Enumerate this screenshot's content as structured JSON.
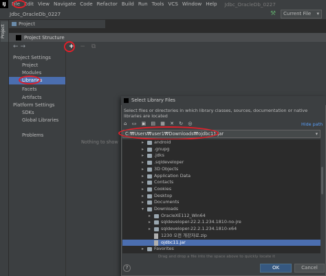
{
  "menubar": {
    "logo": "IJ",
    "items": [
      "File",
      "Edit",
      "View",
      "Navigate",
      "Code",
      "Refactor",
      "Build",
      "Run",
      "Tools",
      "VCS",
      "Window",
      "Help"
    ],
    "window_title": "Jdbc_OracleDb_0227"
  },
  "toolbar": {
    "breadcrumb": "Jdbc_OracleDb_0227",
    "run_config": "Current File"
  },
  "left_strip": {
    "project_tab": "Project"
  },
  "project_panel": {
    "header": "Project"
  },
  "project_structure": {
    "title": "Project Structure",
    "nav": {
      "section_project_settings": "Project Settings",
      "project": "Project",
      "modules": "Modules",
      "libraries": "Libraries",
      "facets": "Facets",
      "artifacts": "Artifacts",
      "section_platform_settings": "Platform Settings",
      "sdks": "SDKs",
      "global_libraries": "Global Libraries",
      "problems": "Problems"
    },
    "middle": {
      "add": "+",
      "remove": "−",
      "copy": "⧉",
      "empty_text": "Nothing to show"
    }
  },
  "select_library_files": {
    "title": "Select Library Files",
    "description": "Select files or directories in which library classes, sources, documentation or native libraries are located",
    "hide_path": "Hide path",
    "path_value": "C:₩Users₩user1₩Downloads₩ojdbc11.jar",
    "tree": [
      {
        "label": "android",
        "type": "folder",
        "indent": 1,
        "expanded": false
      },
      {
        "label": ".gnupg",
        "type": "folder",
        "indent": 1,
        "expanded": false
      },
      {
        "label": ".jdks",
        "type": "folder",
        "indent": 1,
        "expanded": false
      },
      {
        "label": ".sqldeveloper",
        "type": "folder",
        "indent": 1,
        "expanded": false
      },
      {
        "label": "3D Objects",
        "type": "folder",
        "indent": 1,
        "expanded": false
      },
      {
        "label": "Application Data",
        "type": "folder",
        "indent": 1,
        "expanded": false
      },
      {
        "label": "Contacts",
        "type": "folder",
        "indent": 1,
        "expanded": false
      },
      {
        "label": "Cookies",
        "type": "folder",
        "indent": 1,
        "expanded": false
      },
      {
        "label": "Desktop",
        "type": "folder",
        "indent": 1,
        "expanded": false
      },
      {
        "label": "Documents",
        "type": "folder",
        "indent": 1,
        "expanded": false
      },
      {
        "label": "Downloads",
        "type": "folder",
        "indent": 1,
        "expanded": true
      },
      {
        "label": "OracleXE112_Win64",
        "type": "folder",
        "indent": 2,
        "expanded": false
      },
      {
        "label": "sqldeveloper-22.2.1.234.1810-no-jre",
        "type": "folder",
        "indent": 2,
        "expanded": false
      },
      {
        "label": "sqldeveloper-22.2.1.234.1810-x64",
        "type": "folder",
        "indent": 2,
        "expanded": false
      },
      {
        "label": "1230 오전 개강자료.zip",
        "type": "file",
        "indent": 2,
        "expanded": false
      },
      {
        "label": "ojdbc11.jar",
        "type": "file",
        "indent": 2,
        "expanded": false,
        "selected": true
      },
      {
        "label": "Favorites",
        "type": "folder",
        "indent": 1,
        "expanded": false
      }
    ],
    "drag_hint": "Drag and drop a file into the space above to quickly locate it",
    "help": "?",
    "ok": "OK",
    "cancel": "Cancel"
  }
}
